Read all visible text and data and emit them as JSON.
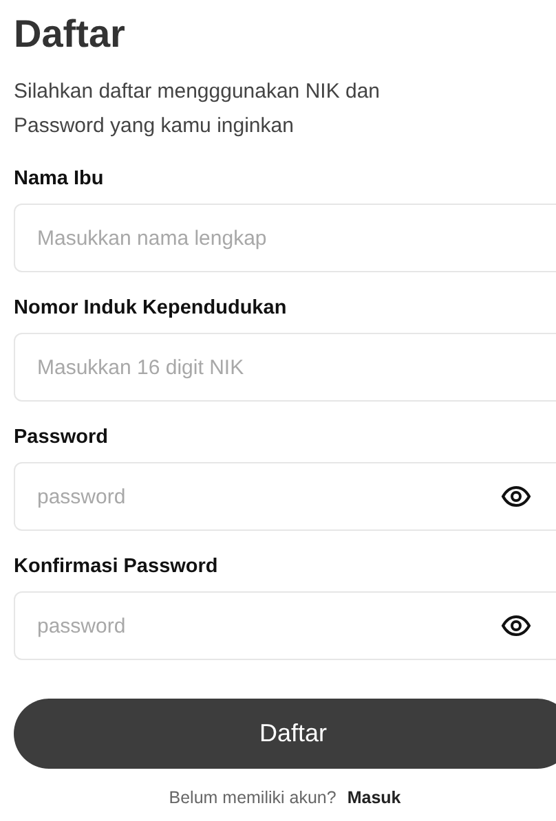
{
  "title": "Daftar",
  "subtitle": "Silahkan daftar mengggunakan NIK dan Password yang kamu inginkan",
  "fields": [
    {
      "label": "Nama Ibu",
      "placeholder": "Masukkan nama lengkap",
      "kind": "text"
    },
    {
      "label": "Nomor Induk Kependudukan",
      "placeholder": "Masukkan 16 digit NIK",
      "kind": "text"
    },
    {
      "label": "Password",
      "placeholder": "password",
      "kind": "password"
    },
    {
      "label": "Konfirmasi Password",
      "placeholder": "password",
      "kind": "password"
    }
  ],
  "submit_button": "Daftar",
  "footer": {
    "prompt": "Belum memiliki akun?",
    "link": "Masuk"
  }
}
